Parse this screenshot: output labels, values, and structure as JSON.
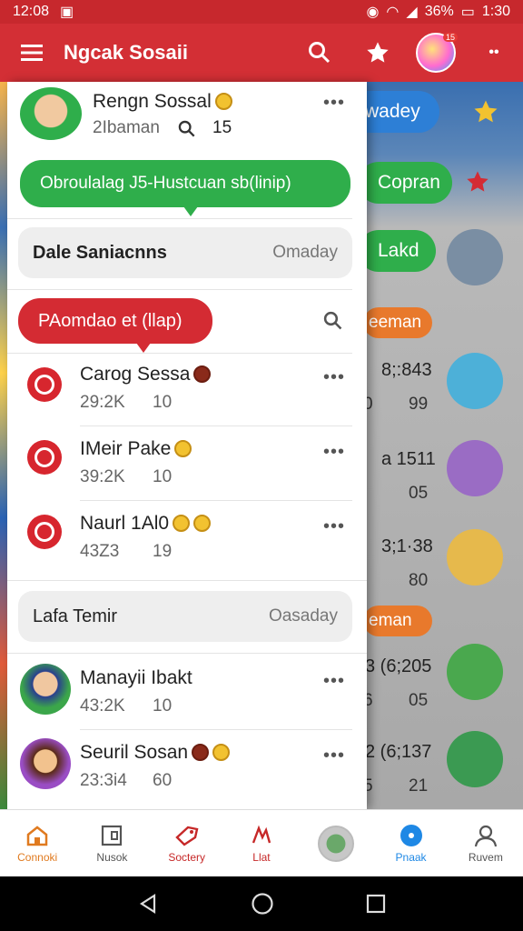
{
  "status": {
    "time": "12:08",
    "battery": "36%",
    "clock": "1:30"
  },
  "appbar": {
    "title": "Ngcak Sosaii",
    "avatar_badge": "15"
  },
  "drawer": {
    "profile": {
      "name": "Rengn Sossal",
      "handle": "2Ibaman",
      "count": "15"
    },
    "bubble_green": "Obroulalag J5-Hustcuan sb(linip)",
    "section1": {
      "title": "Dale Saniacnns",
      "day": "Omaday"
    },
    "bubble_red": "PAomdao et (llap)",
    "items": [
      {
        "name": "Carog Sessa",
        "meta1": "29:2K",
        "meta2": "10"
      },
      {
        "name": "IMeir Pake",
        "meta1": "39:2K",
        "meta2": "10"
      },
      {
        "name": "Naurl 1Al0",
        "meta1": "43Z3",
        "meta2": "19"
      }
    ],
    "section2": {
      "title": "Lafa Temir",
      "day": "Oasaday"
    },
    "people": [
      {
        "name": "Manayii Ibakt",
        "meta1": "43:2K",
        "meta2": "10"
      },
      {
        "name": "Seuril Sosan",
        "meta1": "23:3i4",
        "meta2": "60"
      }
    ],
    "more": "•••"
  },
  "background": {
    "pill_blue": "wadey",
    "pill_green1": "Copran",
    "pill_green2": "Lakd",
    "orange1": "eeman",
    "orange2": "eman",
    "rows": [
      {
        "a": "8;:843",
        "b": "0",
        "c": "99"
      },
      {
        "a": "a 1511",
        "b": "",
        "c": "05"
      },
      {
        "a": "3;1·38",
        "b": "",
        "c": "80"
      },
      {
        "a": "3 (6;205",
        "b": "6",
        "c": "05"
      },
      {
        "a": "2 (6;137",
        "b": "5",
        "c": "21"
      }
    ]
  },
  "bottomnav": [
    {
      "label": "Connoki",
      "color": "#e07a1f"
    },
    {
      "label": "Nusok",
      "color": "#555555"
    },
    {
      "label": "Soctery",
      "color": "#c62828"
    },
    {
      "label": "Llat",
      "color": "#c62828"
    },
    {
      "label": "",
      "color": "#555555"
    },
    {
      "label": "Pnaak",
      "color": "#1e88e5"
    },
    {
      "label": "Ruvem",
      "color": "#555555"
    }
  ],
  "colors": {
    "primary": "#d32f35",
    "green": "#2fae4b",
    "red": "#d42b33"
  }
}
